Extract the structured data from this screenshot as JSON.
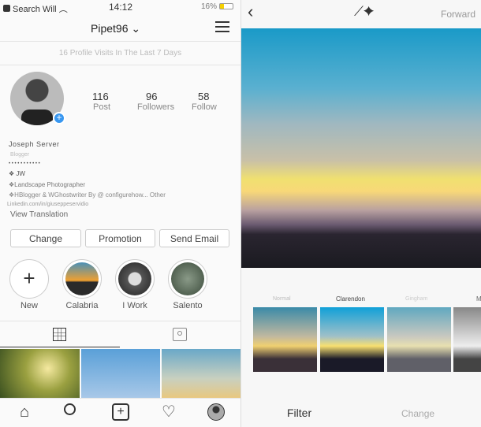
{
  "status_bar": {
    "carrier": "Search Will",
    "time": "14:12",
    "battery": "16%"
  },
  "profile": {
    "username": "Pipet96",
    "visits": "16 Profile Visits In The Last 7 Days",
    "stats": [
      {
        "value": "116",
        "label": "Post"
      },
      {
        "value": "96",
        "label": "Followers"
      },
      {
        "value": "58",
        "label": "Follow"
      }
    ],
    "name": "Joseph Server",
    "category": "Blogger",
    "dots": "• • • • • • • • • • •",
    "bio": [
      "❖ JW",
      "❖Landscape Photographer",
      "❖HBlogger & WGhostwriter By @ configurehow... Other"
    ],
    "link": "Linkedin.com/in/giuseppeservidio",
    "view_translation": "View Translation",
    "buttons": [
      "Change",
      "Promotion",
      "Send Email"
    ],
    "highlights": [
      "New",
      "Calabria",
      "I Work",
      "Salento"
    ]
  },
  "editor": {
    "forward": "Forward",
    "filters": [
      "Normal",
      "Clarendon",
      "Gingham",
      "M"
    ],
    "bottom_tabs": [
      "Filter",
      "Change"
    ]
  }
}
